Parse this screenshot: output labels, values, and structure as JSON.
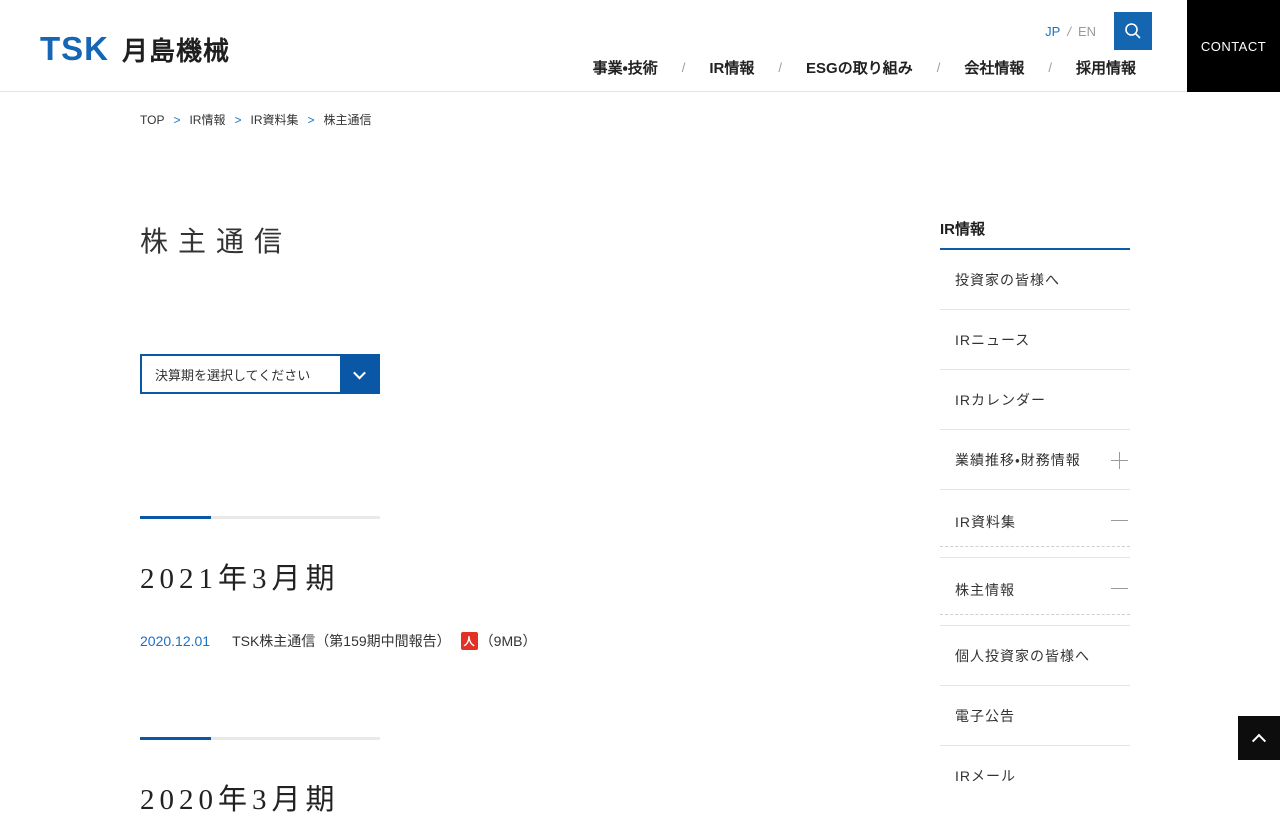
{
  "colors": {
    "accent_blue": "#0a57a6",
    "logo_blue": "#1566b4",
    "link_blue": "#1a72c3",
    "search_btn_blue": "#1566b0",
    "contact_black": "#000000",
    "pdf_red": "#e23226",
    "divider_gray": "#e4e4e4"
  },
  "header": {
    "logo": {
      "mark": "TSK",
      "name": "月島機械"
    },
    "lang": {
      "jp": "JP",
      "sep": "/",
      "en": "EN"
    },
    "search_icon": "magnifier-icon",
    "contact_label": "CONTACT",
    "nav": {
      "sep": "/",
      "items": [
        "事業・技術",
        "IR情報",
        "ESGの取り組み",
        "会社情報",
        "採用情報"
      ]
    }
  },
  "breadcrumb": {
    "sep": ">",
    "items": [
      "TOP",
      "IR情報",
      "IR資料集",
      "株主通信"
    ]
  },
  "main": {
    "title": "株主通信",
    "filter": {
      "label": "決算期を選択してください"
    },
    "sections": [
      {
        "year": "2021年3月期",
        "entries": [
          {
            "date": "2020.12.01",
            "title": "TSK株主通信（第159期中間報告）",
            "pdf_glyph": "人",
            "size": "（9MB）"
          }
        ]
      },
      {
        "year": "2020年3月期",
        "entries": []
      }
    ]
  },
  "sidebar": {
    "title": "IR情報",
    "items": [
      {
        "label": "投資家の皆様へ"
      },
      {
        "label": "IRニュース"
      },
      {
        "label": "IRカレンダー"
      },
      {
        "label": "業績推移・財務情報",
        "expander": "plus"
      },
      {
        "label": "IR資料集",
        "expander": "minus"
      },
      {
        "label": "株主情報",
        "expander": "minus"
      },
      {
        "label": "個人投資家の皆様へ"
      },
      {
        "label": "電子公告"
      },
      {
        "label": "IRメール"
      }
    ]
  }
}
